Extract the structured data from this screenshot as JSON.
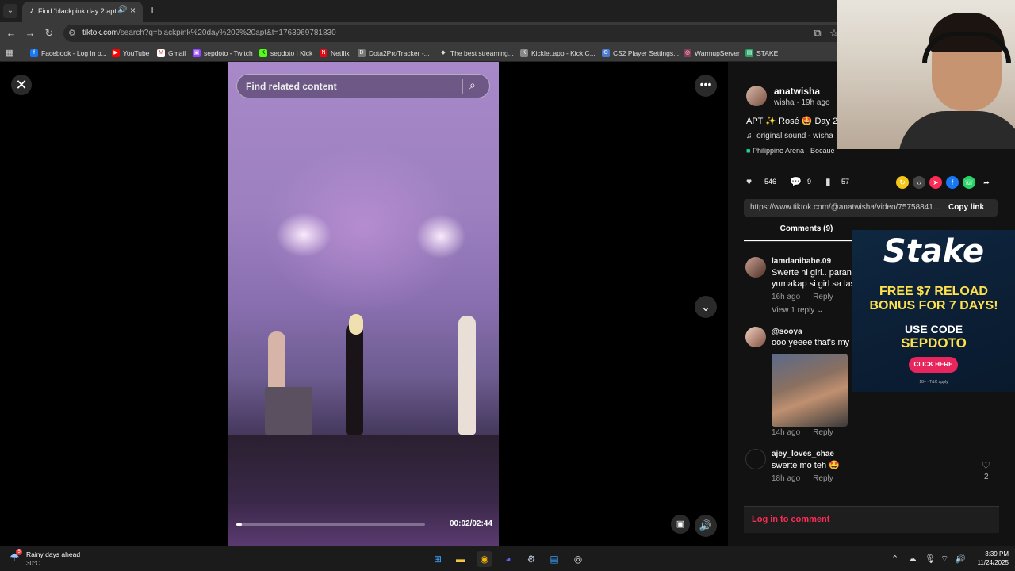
{
  "browser": {
    "tab_title": "Find 'blackpink day 2 apt' o",
    "url_domain": "tiktok.com",
    "url_path": "/search?q=blackpink%20day%202%20apt&t=1763969781830",
    "bookmarks": [
      {
        "label": "Facebook - Log In o...",
        "icon": "facebook-icon",
        "color": "#1877f2"
      },
      {
        "label": "YouTube",
        "icon": "youtube-icon",
        "color": "#ff0000"
      },
      {
        "label": "Gmail",
        "icon": "gmail-icon",
        "color": "#ea4335"
      },
      {
        "label": "sepdoto - Twitch",
        "icon": "twitch-icon",
        "color": "#9146ff"
      },
      {
        "label": "sepdoto | Kick",
        "icon": "kick-icon",
        "color": "#53fc18"
      },
      {
        "label": "Netflix",
        "icon": "netflix-icon",
        "color": "#e50914"
      },
      {
        "label": "Dota2ProTracker -...",
        "icon": "dota-icon",
        "color": "#777777"
      },
      {
        "label": "The best streaming...",
        "icon": "diamond-icon",
        "color": "#dddddd"
      },
      {
        "label": "Kicklet.app - Kick C...",
        "icon": "kicklet-icon",
        "color": "#888888"
      },
      {
        "label": "CS2 Player Settings...",
        "icon": "gear-icon",
        "color": "#4a7bd0"
      },
      {
        "label": "WarmupServer",
        "icon": "warmup-icon",
        "color": "#8a3a5a"
      },
      {
        "label": "STAKE",
        "icon": "sheets-icon",
        "color": "#23a566"
      }
    ]
  },
  "video": {
    "search_placeholder": "Find related content",
    "progress": 0.013,
    "time": "00:02/02:44"
  },
  "post": {
    "username": "anatwisha",
    "meta": "wisha · 19h ago",
    "caption": "APT ✨ Rosé 🤩 Day 2",
    "sound": "original sound - wisha",
    "location": "Philippine Arena · Bocaue",
    "likes": "546",
    "comments": "9",
    "saves": "57",
    "share_link": "https://www.tiktok.com/@anatwisha/video/75758841...",
    "copy_link": "Copy link",
    "comments_tab": "Comments (9)",
    "login_prompt": "Log in to comment"
  },
  "comments": [
    {
      "name": "lamdanibabe.09",
      "text1": "Swerte ni girl.. parang",
      "text2": "yumakap si girl sa las",
      "time": "16h ago",
      "reply": "Reply",
      "view_replies": "View 1 reply"
    },
    {
      "name": "@sooya",
      "text1": "ooo yeeee that's my",
      "time": "14h ago",
      "reply": "Reply"
    },
    {
      "name": "ajey_loves_chae",
      "text1": "swerte mo teh 🤩",
      "time": "18h ago",
      "reply": "Reply",
      "likes": "2"
    }
  ],
  "ad": {
    "brand": "Stake",
    "line1": "FREE $7 RELOAD",
    "line2": "BONUS FOR 7 DAYS!",
    "code_label": "USE CODE",
    "code": "SEPDOTO",
    "button": "CLICK HERE",
    "fine": "18+ · T&C apply"
  },
  "taskbar": {
    "weather_title": "Rainy days ahead",
    "weather_temp": "30°C",
    "weather_badge": "5",
    "time": "3:39 PM",
    "date": "11/24/2025"
  }
}
